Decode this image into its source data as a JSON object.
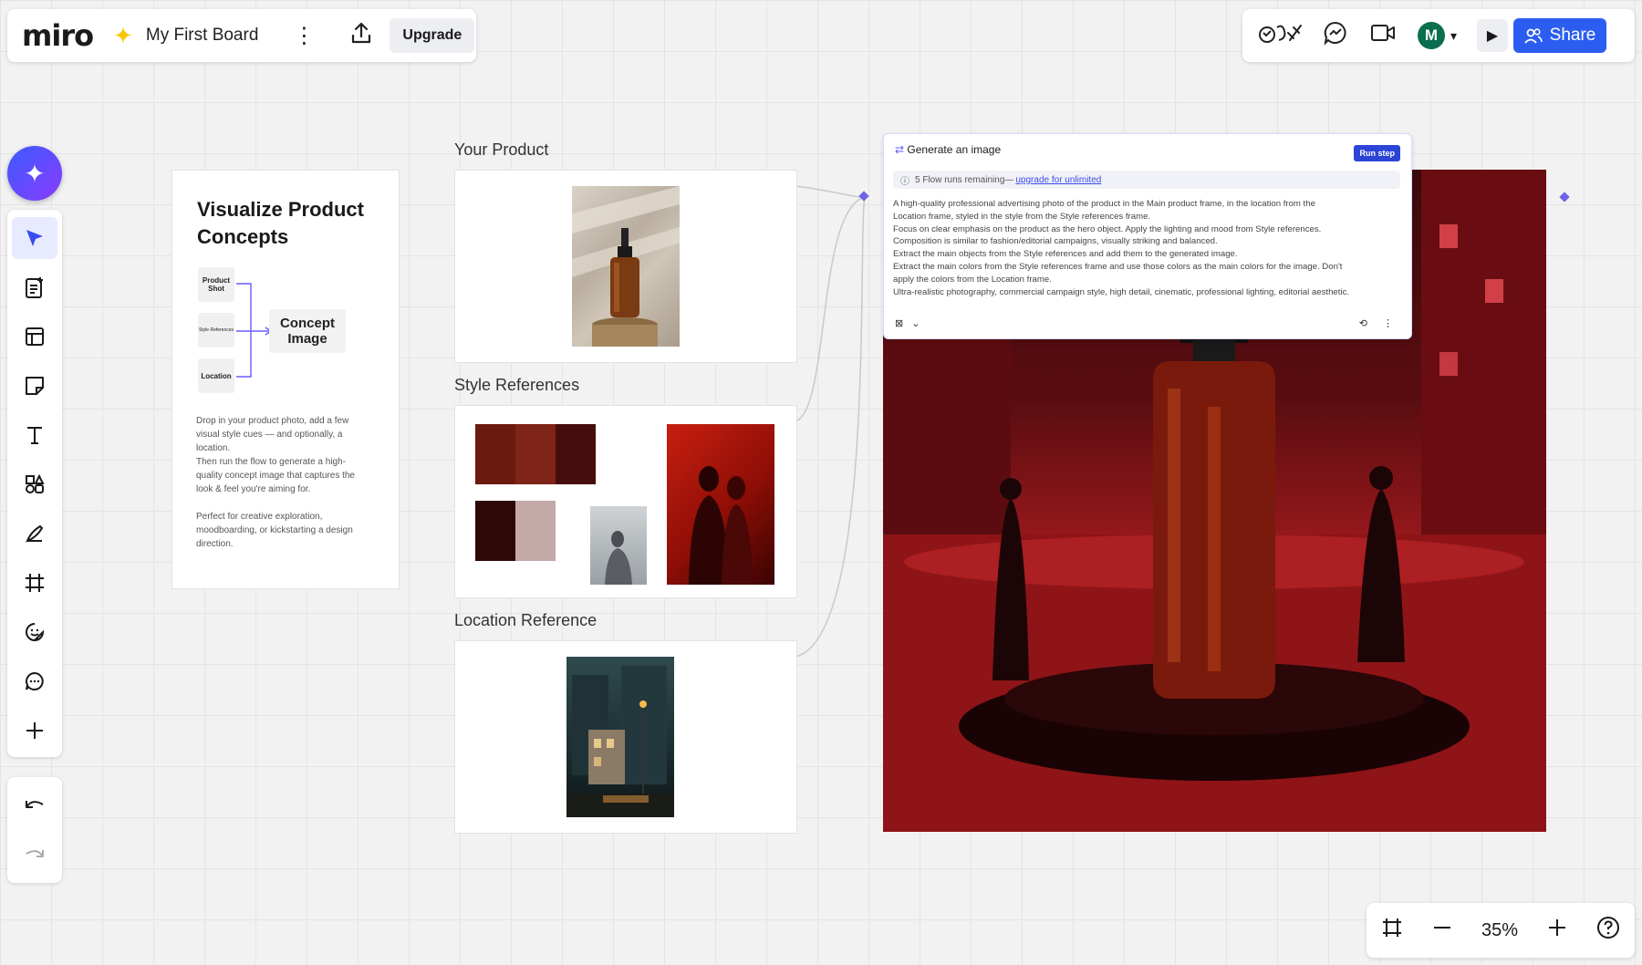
{
  "header": {
    "logo": "miro",
    "board_title": "My First Board",
    "upgrade_label": "Upgrade",
    "avatar_initial": "M",
    "share_label": "Share"
  },
  "left_toolbar": {
    "tools": [
      "select",
      "templates",
      "layout",
      "sticky-note",
      "text",
      "shapes",
      "pen",
      "frame",
      "stickers",
      "comment",
      "add"
    ]
  },
  "flow_card": {
    "title_line1": "Visualize Product",
    "title_line2": "Concepts",
    "node_product": "Product Shot",
    "node_style": "Style References",
    "node_location": "Location",
    "node_concept": "Concept Image",
    "desc_lines": [
      "Drop in your product photo, add a few",
      "visual style cues — and optionally, a",
      "location.",
      "Then run the flow to generate a high-",
      "quality concept image that captures the",
      "look & feel you're aiming for.",
      "",
      "Perfect for creative exploration,",
      "moodboarding, or kickstarting a design",
      "direction."
    ]
  },
  "frames": {
    "product_label": "Your Product",
    "style_label": "Style References",
    "location_label": "Location Reference"
  },
  "palette": {
    "colors": [
      "#6b1a10",
      "#7e2418",
      "#450e0c",
      "#2e0707",
      "#c3a9a7"
    ]
  },
  "generate_panel": {
    "title": "Generate an image",
    "run_label": "Run step",
    "remaining_text": "5 Flow runs remaining—",
    "upgrade_link": "upgrade for unlimited",
    "prompt_lines": [
      "A high-quality professional advertising photo of the product in the Main product frame, in the location from the",
      "Location frame, styled in the style from the Style references frame.",
      "Focus on clear emphasis on the product as the hero object. Apply the lighting and mood from Style references.",
      "Composition is similar to fashion/editorial campaigns, visually striking and balanced.",
      "Extract the main objects from the Style references and add them to the generated image.",
      "Extract the main colors from the Style references frame and use those colors as the main colors for the image. Don't",
      "apply the colors from the Location frame.",
      "Ultra-realistic photography, commercial campaign style, high detail, cinematic, professional lighting, editorial aesthetic."
    ]
  },
  "zoom": {
    "level": "35%"
  },
  "colors": {
    "accent": "#2b5ef0",
    "ai_gradient_start": "#3b5bff",
    "ai_gradient_end": "#8a3bff",
    "canvas": "#f2f2f2"
  }
}
